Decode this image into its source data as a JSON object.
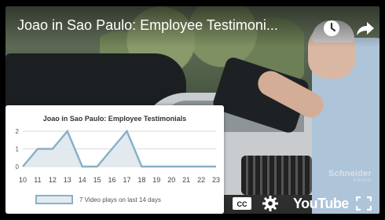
{
  "video": {
    "title": "Joao in Sao Paulo: Employee Testimoni...",
    "brand_line1": "Schneider",
    "brand_line2": "Electric"
  },
  "icons": {
    "clock": "clock-icon",
    "share": "share-icon",
    "captions": "captions-icon",
    "settings": "gear-icon",
    "fullscreen": "fullscreen-icon"
  },
  "controls": {
    "captions_label": "CC",
    "youtube_label": "YouTube"
  },
  "colors": {
    "series": "#89b1c7",
    "grid": "#cccccc"
  },
  "chart_data": {
    "type": "area",
    "title": "Joao in Sao Paulo: Employee Testimonials",
    "x": [
      "10",
      "11",
      "12",
      "13",
      "14",
      "15",
      "16",
      "17",
      "18",
      "19",
      "20",
      "21",
      "22",
      "23"
    ],
    "series": [
      {
        "name": "7 Video plays on last 14 days",
        "values": [
          0,
          1,
          1,
          2,
          0,
          0,
          1,
          2,
          0,
          0,
          0,
          0,
          0,
          0
        ]
      }
    ],
    "yticks": [
      "0",
      "1",
      "2"
    ],
    "ylim": [
      0,
      2
    ],
    "grid": true,
    "legend": "bottom"
  }
}
